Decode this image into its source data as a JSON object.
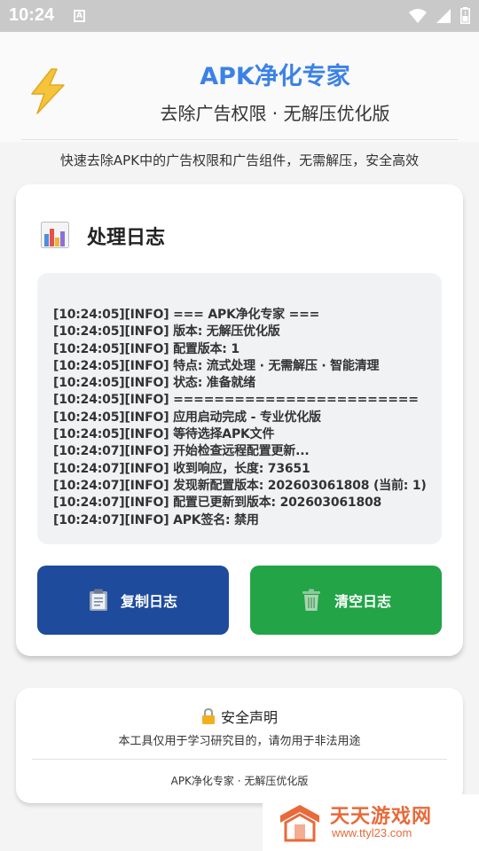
{
  "status_bar": {
    "time": "10:24",
    "notification_badge": "A"
  },
  "header": {
    "title": "APK净化专家",
    "subtitle": "去除广告权限 · 无解压优化版",
    "description": "快速去除APK中的广告权限和广告组件，无需解压，安全高效"
  },
  "log_section": {
    "heading": "处理日志",
    "lines": [
      "[10:24:05][INFO] === APK净化专家 ===",
      "[10:24:05][INFO] 版本: 无解压优化版",
      "[10:24:05][INFO] 配置版本: 1",
      "[10:24:05][INFO] 特点: 流式处理 · 无需解压 · 智能清理",
      "[10:24:05][INFO] 状态: 准备就绪",
      "[10:24:05][INFO] ========================",
      "[10:24:05][INFO] 应用启动完成 - 专业优化版",
      "[10:24:05][INFO] 等待选择APK文件",
      "[10:24:07][INFO] 开始检查远程配置更新...",
      "[10:24:07][INFO] 收到响应，长度: 73651",
      "[10:24:07][INFO] 发现新配置版本: 202603061808 (当前: 1)",
      "[10:24:07][INFO] 配置已更新到版本: 202603061808",
      "[10:24:07][INFO] APK签名: 禁用"
    ],
    "copy_button": "复制日志",
    "clear_button": "清空日志"
  },
  "notice": {
    "title": "安全声明",
    "text": "本工具仅用于学习研究目的，请勿用于非法用途",
    "footer": "APK净化专家 · 无解压优化版"
  },
  "watermark": {
    "title": "天天游戏网",
    "url": "www.ttyl23.com"
  },
  "colors": {
    "title_blue": "#3b82e6",
    "copy_button": "#1e4b9c",
    "clear_button": "#22a447",
    "watermark": "#e86a3a"
  },
  "icons": {
    "bolt": "lightning-icon",
    "log": "bar-chart-icon",
    "copy": "clipboard-icon",
    "clear": "trash-icon",
    "notice": "lock-icon"
  }
}
